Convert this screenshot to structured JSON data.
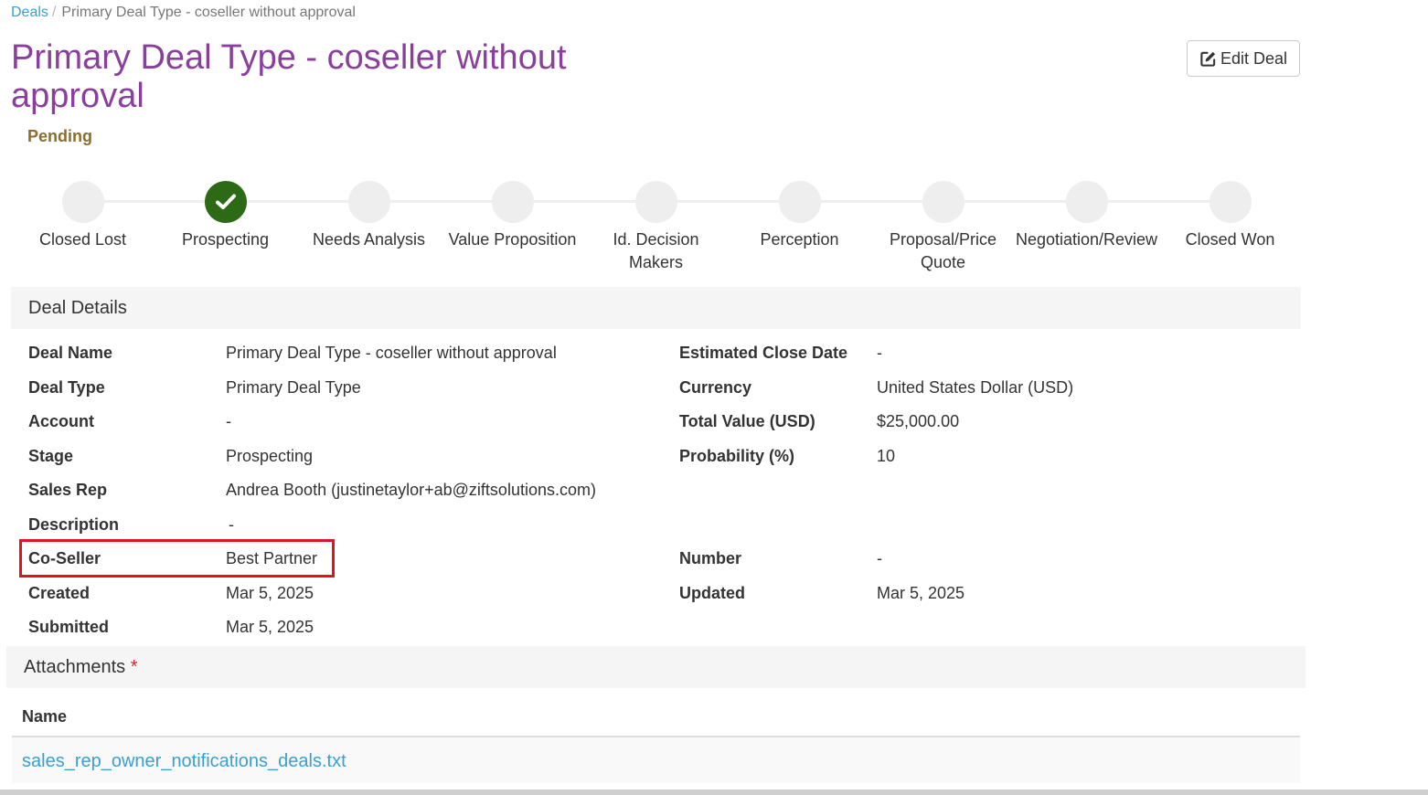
{
  "breadcrumb": {
    "root": "Deals",
    "separator": "/",
    "current": "Primary Deal Type - coseller without approval"
  },
  "header": {
    "title": "Primary Deal Type - coseller without approval",
    "edit_label": "Edit Deal",
    "edit_icon": "edit-square-icon",
    "status": "Pending"
  },
  "stages": [
    {
      "label": "Closed Lost",
      "complete": false
    },
    {
      "label": "Prospecting",
      "complete": true
    },
    {
      "label": "Needs Analysis",
      "complete": false
    },
    {
      "label": "Value Proposition",
      "complete": false
    },
    {
      "label": "Id. Decision Makers",
      "complete": false
    },
    {
      "label": "Perception",
      "complete": false
    },
    {
      "label": "Proposal/Price Quote",
      "complete": false
    },
    {
      "label": "Negotiation/Review",
      "complete": false
    },
    {
      "label": "Closed Won",
      "complete": false
    }
  ],
  "details": {
    "title": "Deal Details",
    "left": [
      {
        "label": "Deal Name",
        "value": "Primary Deal Type - coseller without approval"
      },
      {
        "label": "Deal Type",
        "value": "Primary Deal Type"
      },
      {
        "label": "Account",
        "value": "-"
      },
      {
        "label": "Stage",
        "value": "Prospecting"
      },
      {
        "label": "Sales Rep",
        "value": "Andrea Booth (justinetaylor+ab@ziftsolutions.com)"
      },
      {
        "label": "Description",
        "value": "-"
      },
      {
        "label": "Co-Seller",
        "value": "Best Partner"
      },
      {
        "label": "Created",
        "value": "Mar 5, 2025"
      },
      {
        "label": "Submitted",
        "value": "Mar 5, 2025"
      }
    ],
    "right": [
      {
        "label": "Estimated Close Date",
        "value": "-"
      },
      {
        "label": "Currency",
        "value": "United States Dollar (USD)"
      },
      {
        "label": "Total Value (USD)",
        "value": "$25,000.00"
      },
      {
        "label": "Probability (%)",
        "value": "10"
      },
      {
        "label": "Number",
        "value": "-"
      },
      {
        "label": "Updated",
        "value": "Mar 5, 2025"
      }
    ]
  },
  "attachments": {
    "title": "Attachments",
    "required_marker": "*",
    "column_name": "Name",
    "files": [
      {
        "name": "sales_rep_owner_notifications_deals.txt"
      }
    ]
  },
  "colors": {
    "title": "#8a3f9c",
    "link": "#3b9fd1",
    "status": "#8a6d2f",
    "stage_complete": "#2d6a16",
    "stage_pending": "#eeeeee",
    "highlight": "#e0141e"
  }
}
